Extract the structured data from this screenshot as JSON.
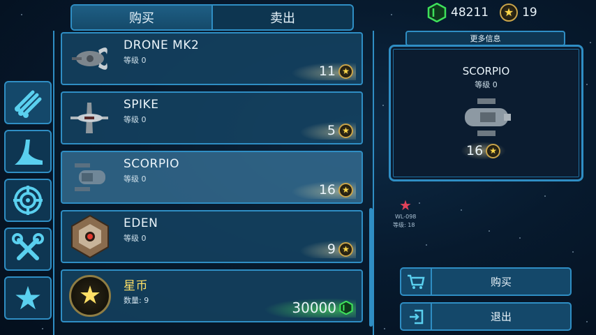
{
  "tabs": [
    {
      "label": "购买",
      "active": true
    },
    {
      "label": "卖出",
      "active": false
    }
  ],
  "currency": {
    "credits": "48211",
    "stars": "19",
    "credits_icon": "green-cube-icon",
    "stars_icon": "star-coin-icon"
  },
  "side_tabs": [
    {
      "icon": "pipes-icon",
      "active": true
    },
    {
      "icon": "fin-icon",
      "active": false
    },
    {
      "icon": "crosshair-icon",
      "active": false
    },
    {
      "icon": "tools-icon",
      "active": false
    },
    {
      "icon": "star-icon",
      "active": false
    }
  ],
  "items": [
    {
      "name": "DRONE MK2",
      "level": "等级 0",
      "price": "11",
      "price_icon": "star-coin-icon"
    },
    {
      "name": "SPIKE",
      "level": "等级 0",
      "price": "5",
      "price_icon": "star-coin-icon"
    },
    {
      "name": "SCORPIO",
      "level": "等级 0",
      "price": "16",
      "price_icon": "star-coin-icon",
      "selected": true
    },
    {
      "name": "EDEN",
      "level": "等级 0",
      "price": "9",
      "price_icon": "star-coin-icon"
    },
    {
      "name": "星币",
      "level": "数量: 9",
      "price": "30000",
      "price_icon": "green-cube-icon"
    }
  ],
  "info": {
    "header": "更多信息",
    "name": "SCORPIO",
    "level": "等级 0",
    "price": "16"
  },
  "map_marker": {
    "name": "WL-098",
    "level": "等级: 18"
  },
  "actions": {
    "buy": "购买",
    "exit": "退出"
  },
  "colors": {
    "frame": "#2f8ec4",
    "panel": "#14486a",
    "gold": "#ffd84a",
    "green": "#3ee05a"
  }
}
